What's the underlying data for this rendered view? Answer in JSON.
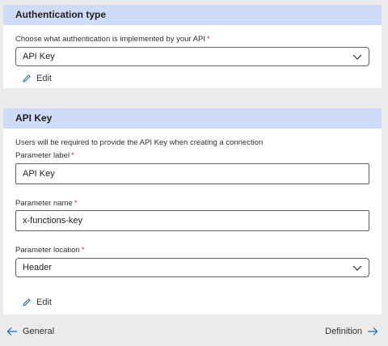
{
  "auth_section": {
    "title": "Authentication type",
    "prompt": "Choose what authentication is implemented by your API",
    "required_mark": "*",
    "selected": "API Key",
    "edit_label": "Edit"
  },
  "apikey_section": {
    "title": "API Key",
    "description": "Users will be required to provide the API Key when creating a connection",
    "param_label": {
      "label": "Parameter label",
      "required_mark": "*",
      "value": "API Key"
    },
    "param_name": {
      "label": "Parameter name",
      "required_mark": "*",
      "value": "x-functions-key"
    },
    "param_location": {
      "label": "Parameter location",
      "required_mark": "*",
      "value": "Header"
    },
    "edit_label": "Edit"
  },
  "footer": {
    "back_label": "General",
    "next_label": "Definition"
  },
  "colors": {
    "section_header": "#cfdcf9",
    "accent": "#0f6cbd",
    "required": "#c4314b"
  },
  "icons": [
    "chevron-down-icon",
    "pencil-icon",
    "arrow-left-icon",
    "arrow-right-icon"
  ]
}
